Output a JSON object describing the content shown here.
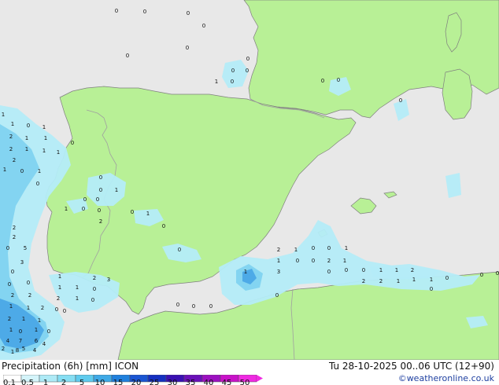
{
  "footer": {
    "legend_title": "Precipitation (6h) [mm] ICON",
    "run_time": "Tu 28-10-2025 00..06 UTC (12+90)",
    "credit": "©weatheronline.co.uk"
  },
  "legend": {
    "ticks": [
      "0.1",
      "0.5",
      "1",
      "2",
      "5",
      "10",
      "15",
      "20",
      "25",
      "30",
      "35",
      "40",
      "45",
      "50"
    ],
    "colors": [
      "#ffffff",
      "#d4f4fa",
      "#aeeaf6",
      "#86def3",
      "#5fcbee",
      "#3fa9e6",
      "#2080dd",
      "#1a55d2",
      "#1530c0",
      "#3a10b2",
      "#6a10b8",
      "#9c10c0",
      "#c812c8",
      "#ef2ae2"
    ]
  },
  "colors": {
    "land": "#b8f096",
    "sea": "#e8e8e8",
    "border": "#a0a0a0",
    "coast": "#7f7f7f",
    "precip_light": "#b4ecf8",
    "precip_mid": "#7fd3f0",
    "precip_strong": "#4aa8e6"
  },
  "map_labels": [
    "0",
    "0",
    "0",
    "0",
    "0",
    "0",
    "0",
    "1",
    "0",
    "0",
    "0",
    "0",
    "0",
    "0",
    "1",
    "1",
    "0",
    "1",
    "2",
    "1",
    "1",
    "2",
    "1",
    "1",
    "1",
    "2",
    "1",
    "0",
    "1",
    "0",
    "0",
    "2",
    "2",
    "0",
    "5",
    "3",
    "0",
    "0",
    "0",
    "2",
    "2",
    "1",
    "1",
    "2",
    "2",
    "1",
    "1",
    "0",
    "1",
    "0",
    "1",
    "0",
    "7",
    "6",
    "4",
    "5",
    "2",
    "8",
    "4",
    "1",
    "4",
    "0",
    "0",
    "1",
    "0",
    "0",
    "1",
    "0",
    "0",
    "2",
    "0",
    "1",
    "0",
    "0",
    "1",
    "2",
    "3",
    "1",
    "1",
    "0",
    "2",
    "1",
    "0",
    "0",
    "0",
    "0",
    "0",
    "2",
    "1",
    "0",
    "0",
    "1",
    "1",
    "0",
    "0",
    "2",
    "1",
    "3",
    "1",
    "0",
    "0",
    "0",
    "1",
    "1",
    "2",
    "2",
    "2",
    "1",
    "1",
    "1",
    "0",
    "0",
    "0",
    "0",
    "0"
  ]
}
